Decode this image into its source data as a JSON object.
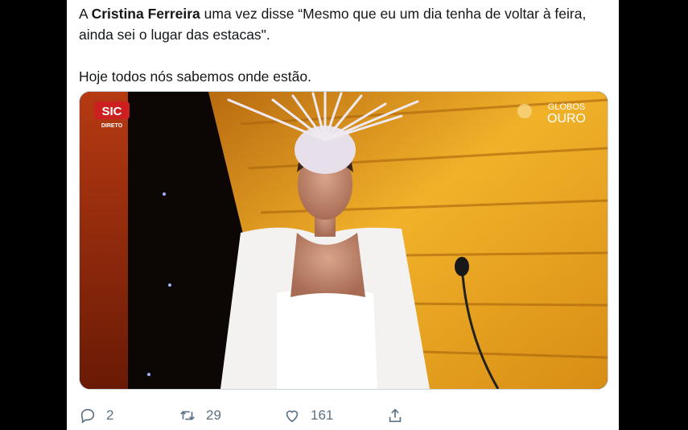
{
  "tweet": {
    "text_prefix": "A ",
    "text_bold": "Cristina Ferreira",
    "text_suffix": " uma vez disse  “Mesmo que eu um dia tenha de voltar à feira, ainda sei o lugar das estacas\".",
    "text_line2": "Hoje todos nós sabemos onde estão."
  },
  "media": {
    "channel_logo": "SIC",
    "channel_status": "DIRETO",
    "event_logo_line1": "GLOBOS",
    "event_logo_line2": "OURO"
  },
  "actions": {
    "reply_count": "2",
    "retweet_count": "29",
    "like_count": "161"
  },
  "colors": {
    "accent_gold": "#e3a21c",
    "text": "#14171a",
    "muted": "#5b7083"
  }
}
